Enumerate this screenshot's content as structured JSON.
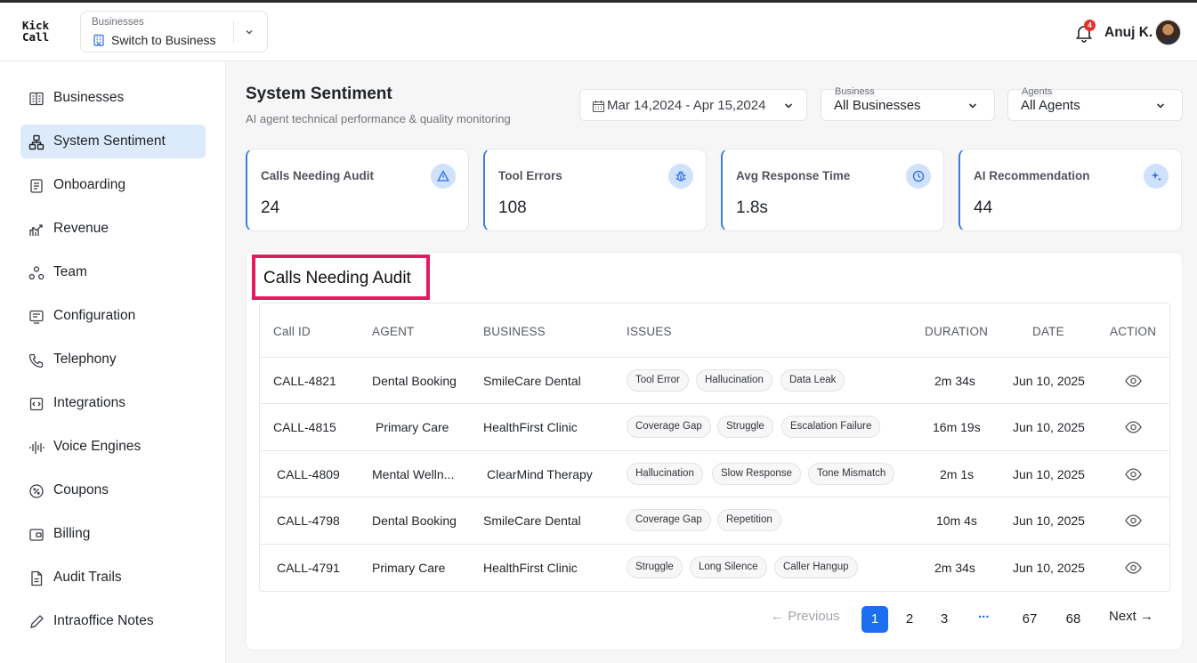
{
  "app": {
    "logo_line1": "Kick",
    "logo_line2": "Call"
  },
  "business_switcher": {
    "caption": "Businesses",
    "value": "Switch to Business"
  },
  "user": {
    "name": "Anuj K.",
    "notifications": "4"
  },
  "sidebar": {
    "items": [
      {
        "label": "Businesses",
        "icon": "building-icon"
      },
      {
        "label": "System Sentiment",
        "icon": "network-icon",
        "active": true
      },
      {
        "label": "Onboarding",
        "icon": "document-icon"
      },
      {
        "label": "Revenue",
        "icon": "revenue-chart-icon"
      },
      {
        "label": "Team",
        "icon": "team-icon"
      },
      {
        "label": "Configuration",
        "icon": "configuration-icon"
      },
      {
        "label": "Telephony",
        "icon": "phone-icon"
      },
      {
        "label": "Integrations",
        "icon": "integrations-icon"
      },
      {
        "label": "Voice Engines",
        "icon": "voice-wave-icon"
      },
      {
        "label": "Coupons",
        "icon": "coupon-icon"
      },
      {
        "label": "Billing",
        "icon": "wallet-icon"
      },
      {
        "label": "Audit Trails",
        "icon": "audit-document-icon"
      },
      {
        "label": "Intraoffice Notes",
        "icon": "pencil-icon"
      }
    ]
  },
  "page": {
    "title": "System Sentiment",
    "subtitle": "AI agent technical performance & quality monitoring"
  },
  "filters": {
    "date_range": "Mar 14,2024 - Apr 15,2024",
    "business": {
      "caption": "Business",
      "value": "All Businesses"
    },
    "agents": {
      "caption": "Agents",
      "value": "All Agents"
    }
  },
  "stats": [
    {
      "label": "Calls Needing Audit",
      "value": "24",
      "icon": "warning-icon"
    },
    {
      "label": "Tool Errors",
      "value": "108",
      "icon": "bug-icon"
    },
    {
      "label": "Avg Response Time",
      "value": "1.8s",
      "icon": "clock-icon"
    },
    {
      "label": "AI Recommendation",
      "value": "44",
      "icon": "sparkle-icon"
    }
  ],
  "audit": {
    "title": "Calls Needing Audit",
    "columns": [
      "Call ID",
      "AGENT",
      "BUSINESS",
      "ISSUES",
      "DURATION",
      "DATE",
      "ACTION"
    ],
    "rows": [
      {
        "id": "CALL-4821",
        "agent": "Dental Booking",
        "business": "SmileCare Dental",
        "issues": [
          "Tool Error",
          "Hallucination",
          "Data Leak"
        ],
        "duration": "2m 34s",
        "date": "Jun 10, 2025"
      },
      {
        "id": "CALL-4815",
        "agent": "Primary Care",
        "business": "HealthFirst Clinic",
        "issues": [
          "Coverage Gap",
          "Struggle",
          "Escalation Failure"
        ],
        "duration": "16m 19s",
        "date": "Jun 10, 2025"
      },
      {
        "id": "CALL-4809",
        "agent": "Mental Welln...",
        "business": "ClearMind Therapy",
        "issues": [
          "Hallucination",
          "Slow Response",
          "Tone Mismatch"
        ],
        "duration": "2m 1s",
        "date": "Jun 10, 2025"
      },
      {
        "id": "CALL-4798",
        "agent": "Dental Booking",
        "business": "SmileCare Dental",
        "issues": [
          "Coverage Gap",
          "Repetition"
        ],
        "duration": "10m 4s",
        "date": "Jun 10, 2025"
      },
      {
        "id": "CALL-4791",
        "agent": "Primary Care",
        "business": "HealthFirst Clinic",
        "issues": [
          "Struggle",
          "Long Silence",
          "Caller Hangup"
        ],
        "duration": "2m 34s",
        "date": "Jun 10, 2025"
      }
    ]
  },
  "pagination": {
    "previous": "Previous",
    "next": "Next",
    "pages": [
      "1",
      "2",
      "3",
      "67",
      "68"
    ],
    "ellipsis": "...",
    "current": "1"
  },
  "colors": {
    "accent": "#1d6ff2",
    "highlight": "#e4195f",
    "active_nav": "#dcebfb",
    "stat_icon_bg": "#cfe1fb"
  }
}
